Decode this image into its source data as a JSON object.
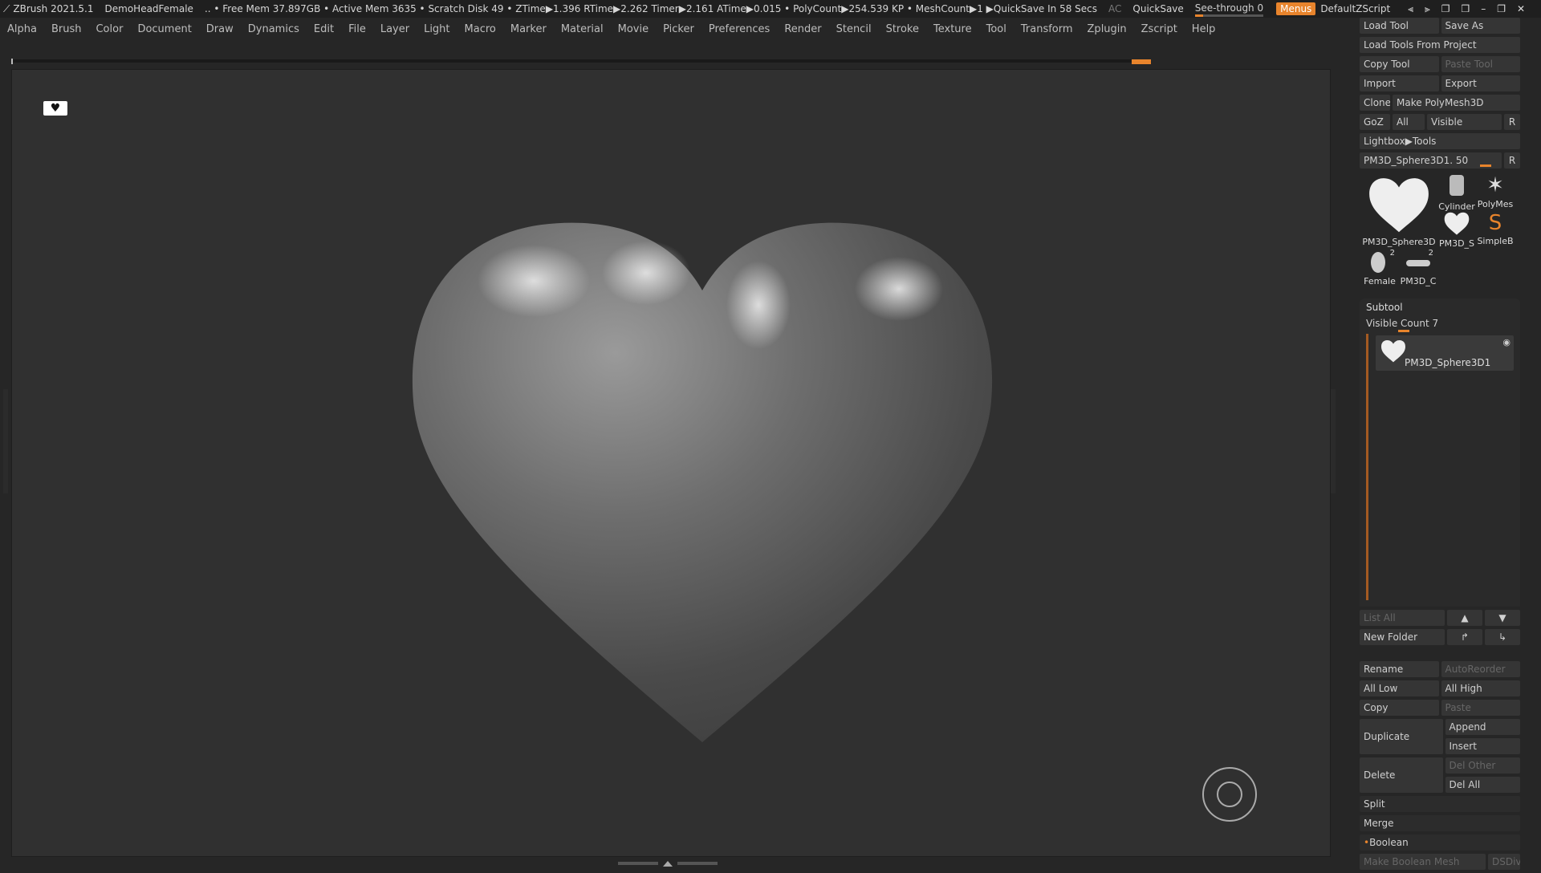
{
  "titlebar": {
    "app": "ZBrush 2021.5.1",
    "doc": "DemoHeadFemale",
    "stats": ".. • Free Mem 37.897GB • Active Mem 3635 • Scratch Disk 49 • ZTime▶1.396 RTime▶2.262 Timer▶2.161 ATime▶0.015 • PolyCount▶254.539 KP • MeshCount▶1 ▶QuickSave In 58 Secs",
    "ac": "AC",
    "quicksave": "QuickSave",
    "seethrough": "See-through  0",
    "menus": "Menus",
    "script": "DefaultZScript"
  },
  "menubar": [
    "Alpha",
    "Brush",
    "Color",
    "Document",
    "Draw",
    "Dynamics",
    "Edit",
    "File",
    "Layer",
    "Light",
    "Macro",
    "Marker",
    "Material",
    "Movie",
    "Picker",
    "Preferences",
    "Render",
    "Stencil",
    "Stroke",
    "Texture",
    "Tool",
    "Transform",
    "Zplugin",
    "Zscript",
    "Help"
  ],
  "tool": {
    "load_tool": "Load Tool",
    "save_as": "Save As",
    "load_from_project": "Load Tools From Project",
    "copy_tool": "Copy Tool",
    "paste_tool": "Paste Tool",
    "import": "Import",
    "export": "Export",
    "clone": "Clone",
    "make_polymesh": "Make PolyMesh3D",
    "goz": "GoZ",
    "all": "All",
    "visible": "Visible",
    "r": "R",
    "lightbox": "Lightbox▶Tools",
    "current_tool": "PM3D_Sphere3D1. 50",
    "tiles": {
      "main": "PM3D_Sphere3D",
      "cylinder": "Cylinder",
      "polymesh": "PolyMes",
      "pm3d_s": "PM3D_S",
      "simpleb": "SimpleB",
      "female": "Female",
      "female_count": "2",
      "pm3d_c": "PM3D_C",
      "pm3d_c_count": "2"
    }
  },
  "subtool": {
    "header": "Subtool",
    "visible_count": "Visible Count 7",
    "item_name": "PM3D_Sphere3D1",
    "list_all": "List All",
    "new_folder": "New Folder",
    "rename": "Rename",
    "autoreorder": "AutoReorder",
    "all_low": "All Low",
    "all_high": "All High",
    "copy": "Copy",
    "paste": "Paste",
    "duplicate": "Duplicate",
    "append": "Append",
    "insert": "Insert",
    "delete": "Delete",
    "del_other": "Del Other",
    "del_all": "Del All",
    "split": "Split",
    "merge": "Merge",
    "boolean": "Boolean",
    "make_boolean_mesh": "Make Boolean Mesh",
    "dsdiv": "DSDiv"
  },
  "colors": {
    "accent": "#e8842c",
    "bg": "#262626",
    "viewport": "#303030"
  }
}
